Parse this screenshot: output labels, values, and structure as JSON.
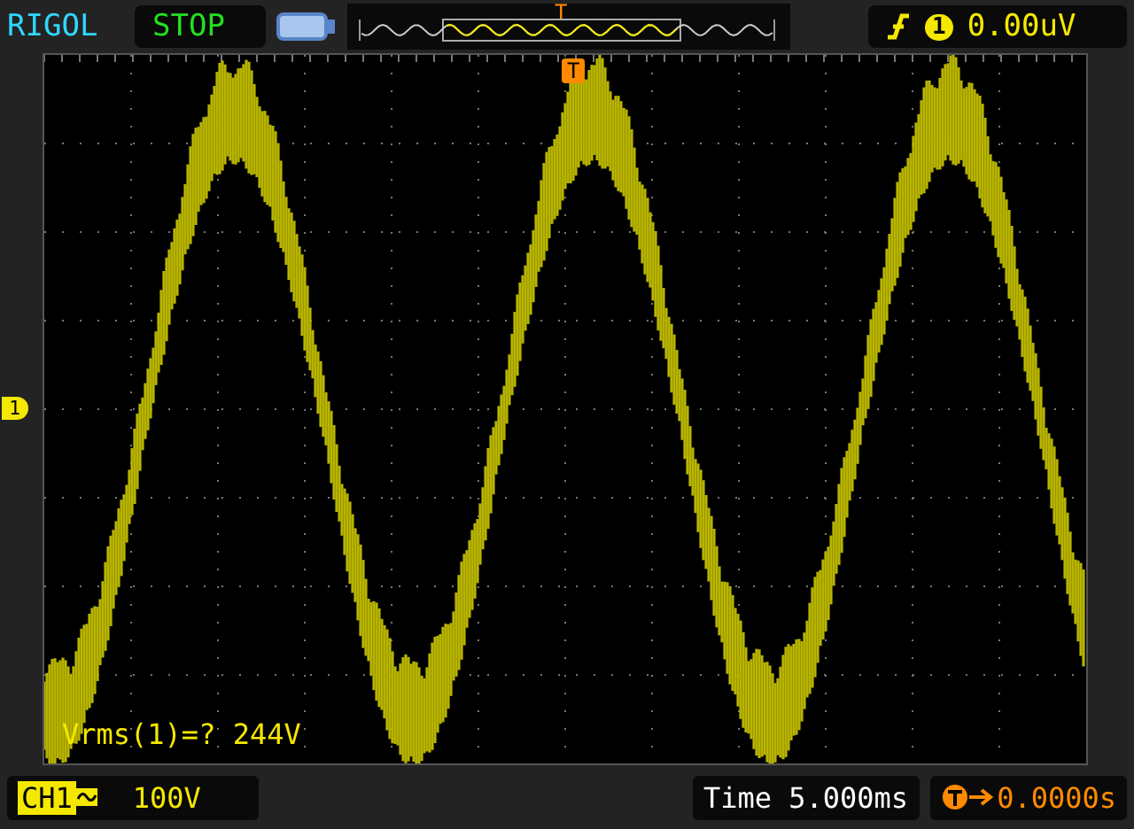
{
  "brand": "RIGOL",
  "run_state": "STOP",
  "memory_bar": {
    "trigger_mark": "T"
  },
  "trigger": {
    "channel": "1",
    "level": "0.00uV"
  },
  "screen": {
    "trigger_marker": "T",
    "channel_marker": "1",
    "measurement": "Vrms(1)=? 244V"
  },
  "channel": {
    "label": "CH1",
    "scale": "100V"
  },
  "timebase": "Time 5.000ms",
  "trigger_offset": "0.0000s"
}
